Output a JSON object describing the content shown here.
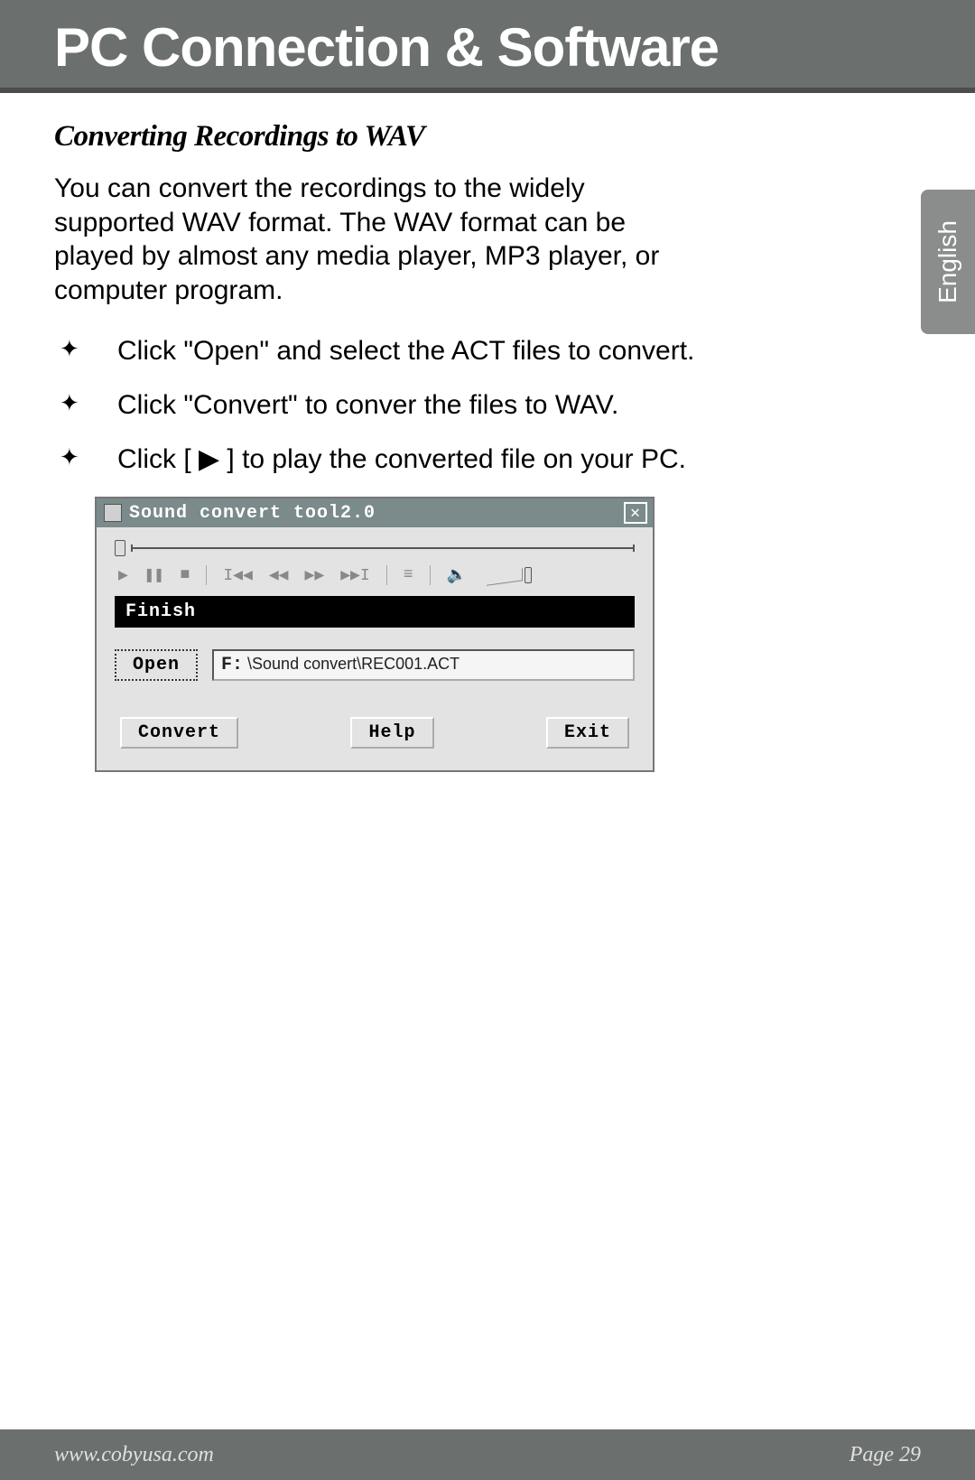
{
  "header": {
    "title": "PC Connection & Software"
  },
  "section": {
    "subheading": "Converting Recordings to WAV",
    "paragraph": "You can convert the recordings to the widely supported WAV format. The WAV format can be played by almost any media player, MP3 player, or computer program.",
    "bullets": [
      "Click \"Open\" and select the ACT files to convert.",
      "Click \"Convert\" to conver the files to WAV.",
      "Click [ ▶ ] to play the converted file on your PC."
    ]
  },
  "dialog": {
    "title": "Sound convert tool2.0",
    "status": "Finish",
    "path_drive": "F:",
    "path_rest": " \\Sound convert\\REC001.ACT",
    "buttons": {
      "open": "Open",
      "convert": "Convert",
      "help": "Help",
      "exit": "Exit"
    }
  },
  "language_tab": "English",
  "footer": {
    "url": "www.cobyusa.com",
    "page": "Page 29"
  }
}
